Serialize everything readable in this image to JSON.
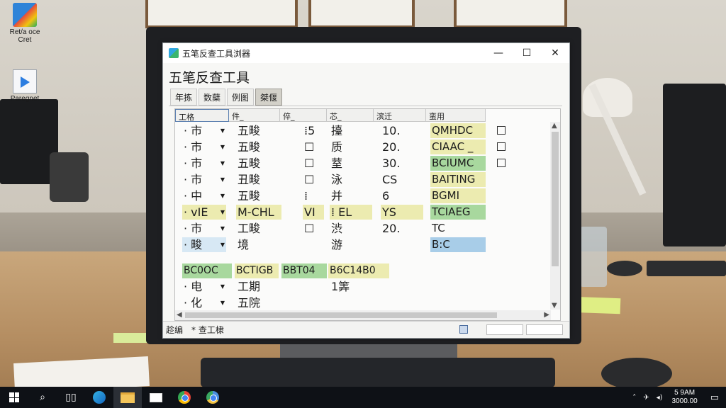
{
  "desktop_icons": [
    {
      "label": "Ret/a oce\nCret",
      "icon": "app-cube-icon"
    },
    {
      "label": "Paregnet",
      "icon": "media-document-icon"
    }
  ],
  "window": {
    "title": "五笔反查工具浏器",
    "heading": "五笔反查工具",
    "controls": {
      "minimize": "—",
      "maximize": "☐",
      "close": "✕"
    },
    "tabs": [
      "年拣",
      "数蘖",
      "例图",
      "桀偃"
    ],
    "active_tab": 3,
    "columns": [
      "工格",
      "件_",
      "倅_",
      "芯_",
      "滨迁",
      "蛮用"
    ],
    "rows": [
      {
        "c0": "市",
        "c1": "五畯",
        "c2": "⁞5",
        "c3": "擡",
        "c4": "10.",
        "c5": "QMHDC",
        "c5_hl": "yellow",
        "check": true
      },
      {
        "c0": "市",
        "c1": "五畯",
        "c2": "☐",
        "c3": "质",
        "c4": "20.",
        "c5": "CIAAC _",
        "c5_hl": "yellow",
        "check": true
      },
      {
        "c0": "市",
        "c1": "五畯",
        "c2": "☐",
        "c3": "荎",
        "c4": "30.",
        "c5": "BCIUMC",
        "c5_hl": "green",
        "check": true
      },
      {
        "c0": "市",
        "c1": "丑畯",
        "c2": "☐",
        "c3": "泳",
        "c4": "CS",
        "c5": "BAITING",
        "c5_hl": "yellow",
        "check": false
      },
      {
        "c0": "中",
        "c1": "五畯",
        "c2": "⁞",
        "c3": "并",
        "c4": "6",
        "c5": "BGMI",
        "c5_hl": "yellow",
        "check": false
      },
      {
        "c0": "vIE",
        "c0_hl": "yellow",
        "c1": "M-CHL",
        "c1_hl": "yellow",
        "c2": "VI",
        "c2_hl": "yellow",
        "c3": "⁞ EL",
        "c3_hl": "yellow",
        "c4": "YS",
        "c4_hl": "yellow",
        "c5": "TCIAEG",
        "c5_hl": "green",
        "check": false
      },
      {
        "c0": "市",
        "c1": "工畯",
        "c2": "☐",
        "c3": "渋",
        "c4": "20.",
        "c5": "TC",
        "c5_hl": "",
        "check": false
      },
      {
        "c0": "畯",
        "c0_hl": "light",
        "c1": "境",
        "c2": "",
        "c3": "游",
        "c4": "",
        "c5": "B:C",
        "c5_hl": "blue",
        "check": false
      }
    ],
    "summary_row": [
      {
        "text": "BC0OC",
        "hl": "green"
      },
      {
        "text": "BCTIGB",
        "hl": "yellow"
      },
      {
        "text": "BBT04",
        "hl": "green"
      },
      {
        "text": "B6C14B0",
        "hl": "yellow"
      }
    ],
    "extra_rows": [
      {
        "c0": "电",
        "c1": "工期",
        "c3": "1筭"
      },
      {
        "c0": "化",
        "c1": "五院",
        "c3": ""
      }
    ],
    "status": {
      "left": "趁编",
      "mid": "* 查工棣"
    }
  },
  "taskbar": {
    "items": [
      "start",
      "search",
      "task-view",
      "edge",
      "file-explorer",
      "mail",
      "chrome",
      "chrome"
    ],
    "clock_time": "5 9AM",
    "clock_date": "3000.00"
  }
}
